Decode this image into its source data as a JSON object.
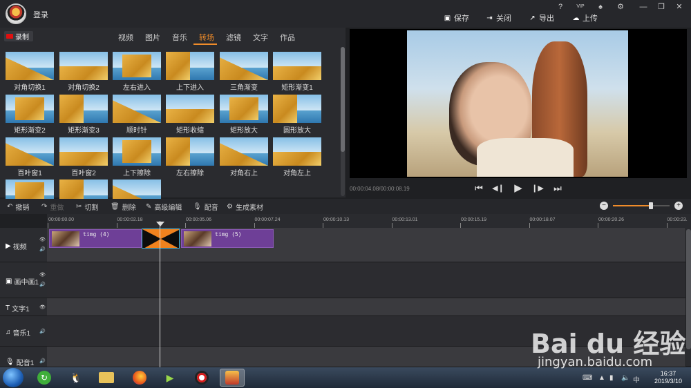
{
  "header": {
    "login": "登录",
    "window_controls": [
      "?",
      "VIP",
      "♠",
      "⚙",
      "—",
      "❐",
      "✕"
    ],
    "actions": [
      {
        "label": "保存",
        "icon": "save-icon"
      },
      {
        "label": "关闭",
        "icon": "close-icon"
      },
      {
        "label": "导出",
        "icon": "export-icon"
      },
      {
        "label": "上传",
        "icon": "upload-icon"
      }
    ]
  },
  "media_panel": {
    "record_label": "录制",
    "tabs": [
      "视频",
      "图片",
      "音乐",
      "转场",
      "滤镜",
      "文字",
      "作品"
    ],
    "active_tab": "转场",
    "transitions": [
      "对角切换1",
      "对角切换2",
      "左右进入",
      "上下进入",
      "三角渐变",
      "矩形渐变1",
      "矩形渐变2",
      "矩形渐变3",
      "顺时针",
      "矩形收缩",
      "矩形放大",
      "圆形放大",
      "百叶窗1",
      "百叶窗2",
      "上下擦除",
      "左右擦除",
      "对角右上",
      "对角左上",
      "",
      "",
      ""
    ]
  },
  "preview": {
    "timecode": "00:00:04.08/00:00:08.19",
    "controls": [
      "⏮",
      "◀❙",
      "▶",
      "❙▶",
      "⏭"
    ]
  },
  "toolbar": {
    "undo": "撤销",
    "redo": "重做",
    "cut": "切割",
    "delete": "删除",
    "advanced": "高级编辑",
    "dub": "配音",
    "generate": "生成素材",
    "zoom_level": 0.66
  },
  "timeline": {
    "ruler": [
      "00:00:00.00",
      "00:00:02.18",
      "00:00:05.06",
      "00:00:07.24",
      "00:00:10.13",
      "00:00:13.01",
      "00:00:15.19",
      "00:00:18.07",
      "00:00:20.26",
      "00:00:23."
    ],
    "tracks": [
      "视频",
      "画中画1",
      "文字1",
      "音乐1",
      "配音1"
    ],
    "clips": [
      "timg (4)",
      "timg (5)"
    ]
  },
  "taskbar": {
    "time": "16:37",
    "date": "2019/3/10"
  },
  "watermark": {
    "brand": "Bai du 经验",
    "url": "jingyan.baidu.com"
  }
}
